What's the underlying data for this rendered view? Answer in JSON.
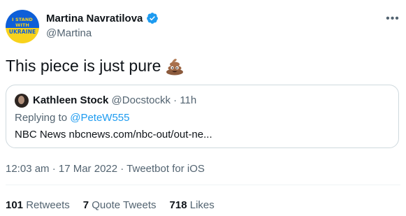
{
  "author": {
    "name": "Martina Navratilova",
    "handle": "@Martina",
    "avatar_text": [
      "I STAND",
      "WITH",
      "UKRAINE"
    ]
  },
  "tweet": {
    "text": "This piece is just pure",
    "emoji": "poo-emoji"
  },
  "quote": {
    "name": "Kathleen Stock",
    "handle": "@Docstockk",
    "separator": "·",
    "time": "11h",
    "replying_prefix": "Replying to",
    "replying_to": "@PeteW555",
    "body": "NBC News nbcnews.com/nbc-out/out-ne..."
  },
  "meta": {
    "timestamp": "12:03 am · 17 Mar 2022 · Tweetbot for iOS"
  },
  "stats": [
    {
      "count": "101",
      "label": "Retweets"
    },
    {
      "count": "7",
      "label": "Quote Tweets"
    },
    {
      "count": "718",
      "label": "Likes"
    }
  ],
  "colors": {
    "accent": "#1d9bf0",
    "secondary_text": "#536471",
    "border": "#cfd9de"
  },
  "icons": [
    "verified-badge-icon",
    "more-options-icon",
    "poo-emoji"
  ]
}
